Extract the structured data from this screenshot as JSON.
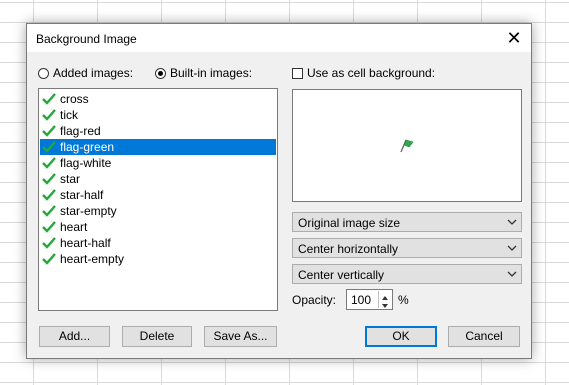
{
  "dialog": {
    "title": "Background Image",
    "close_glyph": "✕"
  },
  "source": {
    "added_label": "Added images:",
    "builtin_label": "Built-in images:",
    "selected": "builtin"
  },
  "cell_background": {
    "label": "Use as cell background:",
    "checked": false
  },
  "images": [
    {
      "label": "cross"
    },
    {
      "label": "tick"
    },
    {
      "label": "flag-red"
    },
    {
      "label": "flag-green"
    },
    {
      "label": "flag-white"
    },
    {
      "label": "star"
    },
    {
      "label": "star-half"
    },
    {
      "label": "star-empty"
    },
    {
      "label": "heart"
    },
    {
      "label": "heart-half"
    },
    {
      "label": "heart-empty"
    }
  ],
  "selected_image": "flag-green",
  "options": {
    "size": "Original image size",
    "horizontal": "Center horizontally",
    "vertical": "Center vertically"
  },
  "opacity": {
    "label": "Opacity:",
    "value": "100",
    "unit": "%"
  },
  "buttons": {
    "add": "Add...",
    "delete": "Delete",
    "save_as": "Save As...",
    "ok": "OK",
    "cancel": "Cancel"
  },
  "colors": {
    "accent": "#0078d7",
    "tick_green": "#22a83a"
  }
}
